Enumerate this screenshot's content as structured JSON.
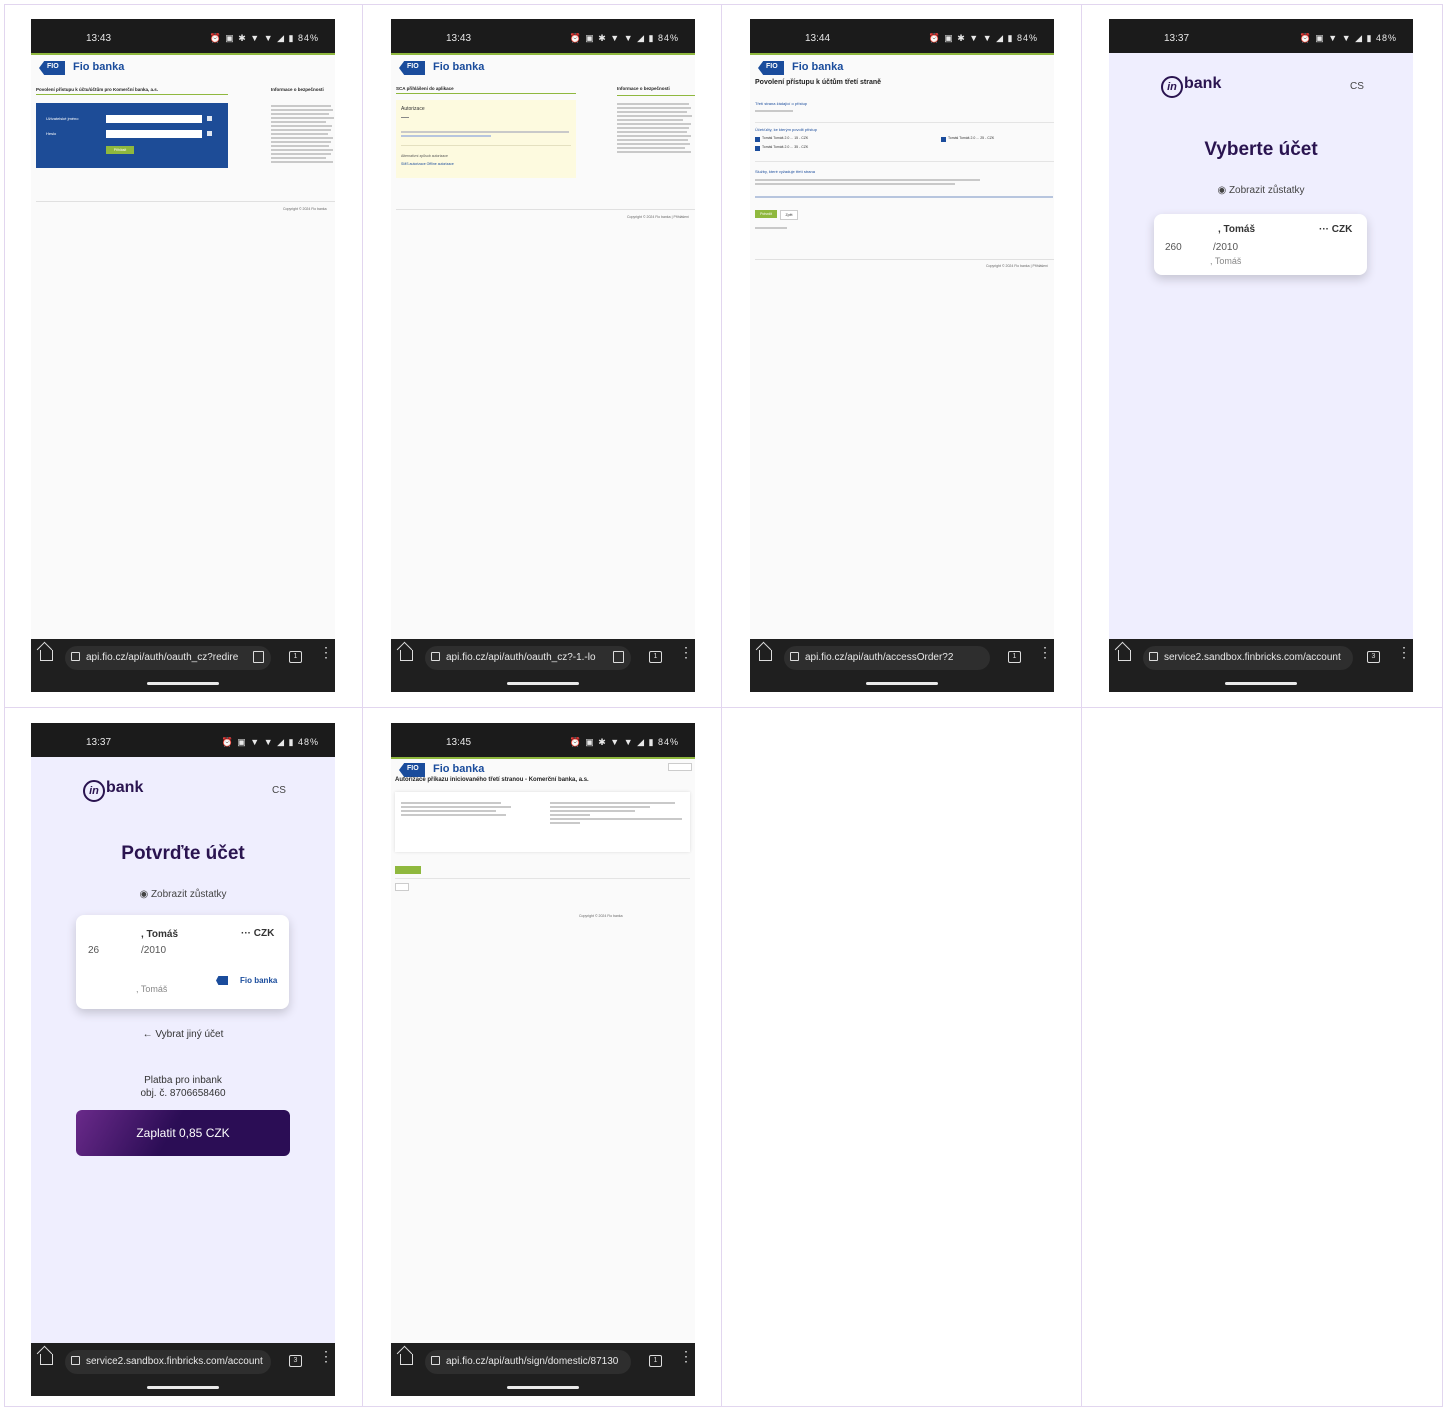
{
  "screens": [
    {
      "time": "13:43",
      "battery": "84%",
      "bank": "Fio banka",
      "heading": "Povolení přístupu k účtu/účtům pro Komerční banka, a.s.",
      "side_heading": "Informace o bezpečnosti",
      "login_label": "Uživatelské jméno",
      "password_label": "Heslo",
      "login_button": "Přihlásit",
      "copyright": "Copyright © 2024 Fio banka",
      "url": "api.fio.cz/api/auth/oauth_cz?redire"
    },
    {
      "time": "13:43",
      "battery": "84%",
      "bank": "Fio banka",
      "heading": "SCA přihlášení do aplikace",
      "side_heading": "Informace o bezpečnosti",
      "auth_title": "Autorizace",
      "alt_label": "Alternativní způsob autorizace",
      "alt_links": "SMS autorizace   Offline autorizace",
      "copyright": "Copyright © 2024 Fio banka | Přihlášení",
      "url": "api.fio.cz/api/auth/oauth_cz?-1.-lo"
    },
    {
      "time": "13:44",
      "battery": "84%",
      "bank": "Fio banka",
      "heading": "Povolení přístupu k účtům třetí straně",
      "sub1": "Třetí strana žádající o přístup",
      "sub2": "Účet/účty, ke kterým povolit přístup",
      "acc1": "Tomáš Tomáš 2.0 ... 15 - CZK",
      "acc2": "Tomáš Tomáš 2.0 ... 25 - CZK",
      "acc3": "Tomáš Tomáš 2.0 ... 35 - CZK",
      "sub3": "Služby, které vyžaduje třetí strana",
      "confirm_button": "Potvrdit",
      "cancel_button": "Zpět",
      "copyright": "Copyright © 2024 Fio banka | Přihlášení",
      "url": "api.fio.cz/api/auth/accessOrder?2"
    },
    {
      "time": "13:37",
      "battery": "48%",
      "lang": "CS",
      "title": "Vyberte účet",
      "show_balance": "Zobrazit zůstatky",
      "card_name": ", Tomáš",
      "card_currency": "··· CZK",
      "card_prefix": "260",
      "card_suffix": "/2010",
      "card_owner": ", Tomáš",
      "url": "service2.sandbox.finbricks.com/account"
    },
    {
      "time": "13:37",
      "battery": "48%",
      "lang": "CS",
      "title": "Potvrďte účet",
      "show_balance": "Zobrazit zůstatky",
      "card_name": ", Tomáš",
      "card_currency": "··· CZK",
      "card_prefix": "26",
      "card_suffix": "/2010",
      "card_owner": ", Tomáš",
      "card_bank": "Fio banka",
      "other_account": "← Vybrat jiný účet",
      "payment_for": "Platba pro inbank",
      "order": "obj. č. 8706658460",
      "pay_button": "Zaplatit 0,85 CZK",
      "url": "service2.sandbox.finbricks.com/account"
    },
    {
      "time": "13:45",
      "battery": "84%",
      "bank": "Fio banka",
      "heading": "Autorizace příkazu iniciovaného třetí stranou - Komerční banka, a.s.",
      "copyright": "Copyright © 2024 Fio banka",
      "url": "api.fio.cz/api/auth/sign/domestic/87130"
    }
  ]
}
